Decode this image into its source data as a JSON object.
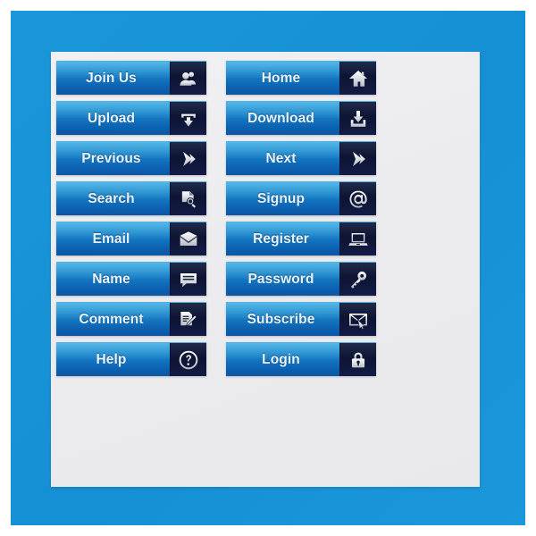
{
  "theme": {
    "frame_color": "#1694d8",
    "panel_color": "#ededef",
    "button_gradient_top": "#2aa5e0",
    "button_gradient_bottom": "#0b57a4",
    "icon_box_color": "#0d1433",
    "label_text_color": "#e9f2fb",
    "icon_color": "#ffffff"
  },
  "buttons": {
    "left_column": [
      {
        "label": "Join Us",
        "icon": "users-icon"
      },
      {
        "label": "Upload",
        "icon": "upload-arrow-icon"
      },
      {
        "label": "Previous",
        "icon": "arrow-right-chevron-icon"
      },
      {
        "label": "Search",
        "icon": "document-magnifier-icon"
      },
      {
        "label": "Email",
        "icon": "envelope-open-icon"
      },
      {
        "label": "Name",
        "icon": "speech-bubble-icon"
      },
      {
        "label": "Comment",
        "icon": "document-pen-icon"
      },
      {
        "label": "Help",
        "icon": "question-mark-circle-icon"
      }
    ],
    "right_column": [
      {
        "label": "Home",
        "icon": "house-icon"
      },
      {
        "label": "Download",
        "icon": "download-arrow-tray-icon"
      },
      {
        "label": "Next",
        "icon": "arrow-right-chevron-icon"
      },
      {
        "label": "Signup",
        "icon": "at-sign-icon"
      },
      {
        "label": "Register",
        "icon": "laptop-icon"
      },
      {
        "label": "Password",
        "icon": "key-icon"
      },
      {
        "label": "Subscribe",
        "icon": "envelope-cursor-icon"
      },
      {
        "label": "Login",
        "icon": "padlock-icon"
      }
    ]
  }
}
